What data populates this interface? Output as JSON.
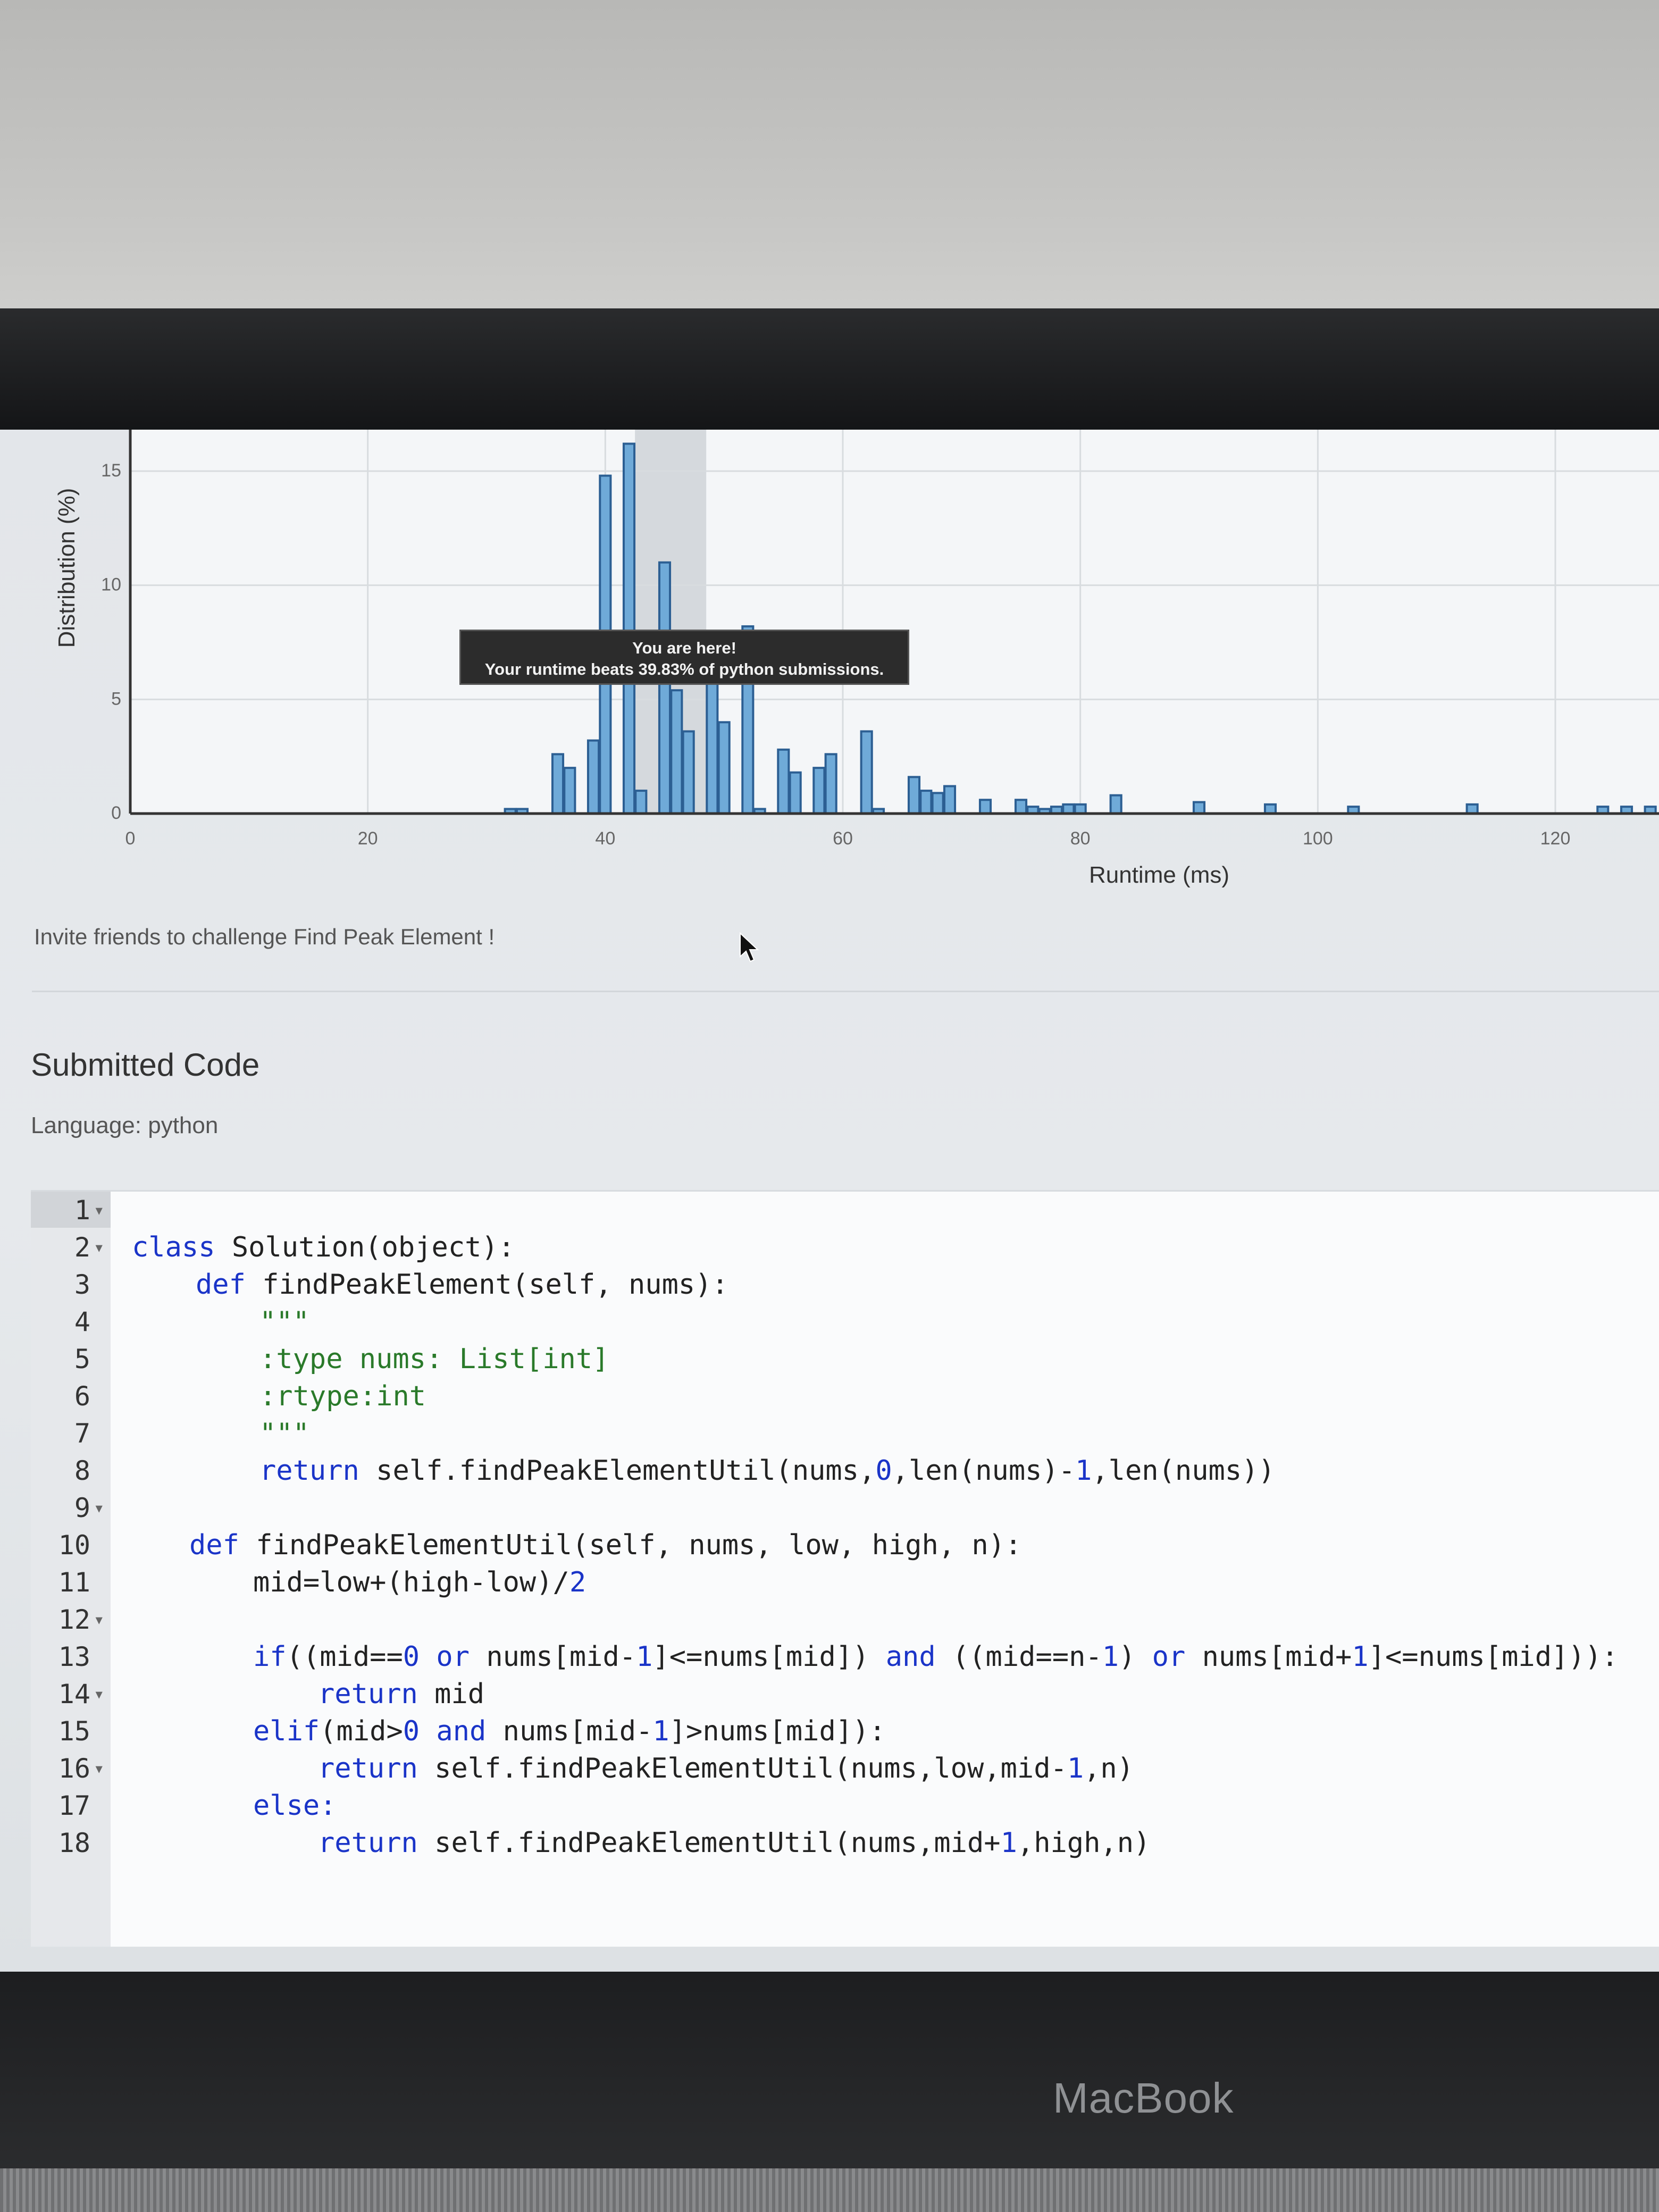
{
  "chart_data": {
    "type": "bar",
    "xlabel": "Runtime (ms)",
    "ylabel": "Distribution (%)",
    "xlim": [
      0,
      130
    ],
    "ylim": [
      0,
      16
    ],
    "xticks": [
      0,
      20,
      40,
      60,
      80,
      100,
      120
    ],
    "yticks": [
      0,
      5,
      10,
      15
    ],
    "grid": true,
    "x": [
      32,
      33,
      36,
      37,
      39,
      40,
      42,
      43,
      45,
      46,
      47,
      49,
      50,
      52,
      53,
      55,
      56,
      58,
      59,
      62,
      63,
      66,
      67,
      68,
      69,
      72,
      75,
      76,
      77,
      78,
      79,
      80,
      83,
      90,
      96,
      103,
      113,
      124,
      126,
      128
    ],
    "values": [
      0.2,
      0.2,
      2.6,
      2.0,
      3.2,
      14.8,
      16.2,
      1.0,
      11.0,
      5.4,
      3.6,
      5.7,
      4.0,
      8.2,
      0.2,
      2.8,
      1.8,
      2.0,
      2.6,
      3.6,
      0.2,
      1.6,
      1.0,
      0.9,
      1.2,
      0.6,
      0.6,
      0.3,
      0.2,
      0.3,
      0.4,
      0.4,
      0.8,
      0.5,
      0.4,
      0.3,
      0.4,
      0.3,
      0.3,
      0.3
    ],
    "tooltip": {
      "line1": "You are here!",
      "line2": "Your runtime beats 39.83% of python submissions."
    }
  },
  "invite_text": "Invite friends to challenge Find Peak Element !",
  "submitted_code": {
    "title": "Submitted Code",
    "language_label": "Language:",
    "language_value": "python",
    "lines": [
      {
        "n": "1",
        "fold": true
      },
      {
        "n": "2",
        "fold": true
      },
      {
        "n": "3",
        "fold": false
      },
      {
        "n": "4",
        "fold": false
      },
      {
        "n": "5",
        "fold": false
      },
      {
        "n": "6",
        "fold": false
      },
      {
        "n": "7",
        "fold": false
      },
      {
        "n": "8",
        "fold": false
      },
      {
        "n": "9",
        "fold": true
      },
      {
        "n": "10",
        "fold": false
      },
      {
        "n": "11",
        "fold": false
      },
      {
        "n": "12",
        "fold": true
      },
      {
        "n": "13",
        "fold": false
      },
      {
        "n": "14",
        "fold": true
      },
      {
        "n": "15",
        "fold": false
      },
      {
        "n": "16",
        "fold": true
      },
      {
        "n": "17",
        "fold": false
      },
      {
        "n": "18",
        "fold": false
      }
    ],
    "code": {
      "l1_kw": "class",
      "l1_rest": " Solution(object):",
      "l2_kw": "def",
      "l2_rest": " findPeakElement(self, nums):",
      "l3": "\"\"\"",
      "l4": ":type nums: List[int]",
      "l5": ":rtype:int",
      "l6": "\"\"\"",
      "l7_kw": "return",
      "l7_a": " self.findPeakElementUtil(nums,",
      "l7_n0": "0",
      "l7_b": ",len(nums)-",
      "l7_n1": "1",
      "l7_c": ",len(nums))",
      "l9_kw": "def",
      "l9_rest": " findPeakElementUtil(self, nums, low, high, n):",
      "l10_a": "mid=low+(high-low)/",
      "l10_n": "2",
      "l12_kw": "if",
      "l12_a": "((mid==",
      "l12_n0": "0",
      "l12_or1": " or",
      "l12_b": " nums[mid-",
      "l12_n1": "1",
      "l12_c": "]<=nums[mid])",
      "l12_and": " and",
      "l12_d": " ((mid==n-",
      "l12_n2": "1",
      "l12_e": ")",
      "l12_or2": " or",
      "l12_f": " nums[mid+",
      "l12_n3": "1",
      "l12_g": "]<=nums[mid])):",
      "l13_kw": "return",
      "l13_rest": " mid",
      "l14_kw": "elif",
      "l14_a": "(mid>",
      "l14_n0": "0",
      "l14_and": " and",
      "l14_b": " nums[mid-",
      "l14_n1": "1",
      "l14_c": "]>nums[mid]):",
      "l15_kw": "return",
      "l15_a": " self.findPeakElementUtil(nums,low,mid-",
      "l15_n": "1",
      "l15_b": ",n)",
      "l16_kw": "else:",
      "l17_kw": "return",
      "l17_a": " self.findPeakElementUtil(nums,mid+",
      "l17_n": "1",
      "l17_b": ",high,n)"
    }
  },
  "brand": "MacBook"
}
